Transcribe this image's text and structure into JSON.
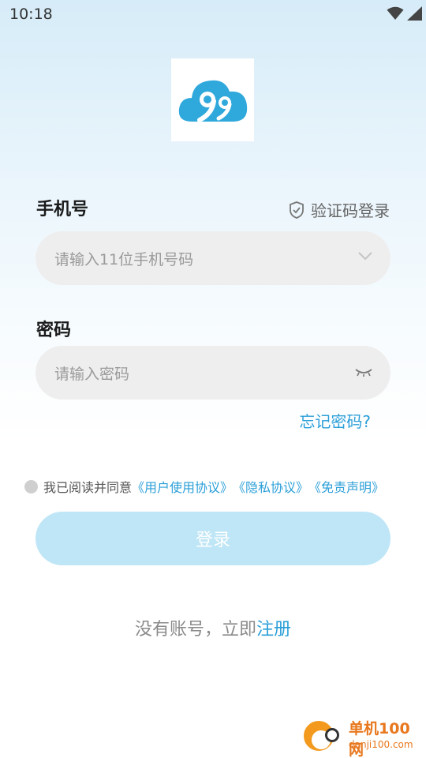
{
  "status_bar": {
    "time": "10:18",
    "icons": [
      "wifi-icon",
      "signal-icon",
      "battery-icon"
    ]
  },
  "logo": {
    "icon": "cloud-99-logo",
    "color": "#2fa8dc"
  },
  "phone": {
    "label": "手机号",
    "verify_login": "验证码登录",
    "placeholder": "请输入11位手机号码",
    "dropdown_icon": "chevron-down-icon"
  },
  "password": {
    "label": "密码",
    "placeholder": "请输入密码",
    "visibility_icon": "eye-closed-icon",
    "forgot": "忘记密码?"
  },
  "agreement": {
    "prefix": "我已阅读并同意",
    "user_agreement": "《用户使用协议》",
    "privacy": "《隐私协议》",
    "disclaimer": "《免责声明》"
  },
  "login_button": "登录",
  "register": {
    "prefix": "没有账号，立即",
    "link": "注册"
  },
  "watermark": {
    "title": "单机100网",
    "subtitle": "danji100.com"
  },
  "colors": {
    "accent": "#2b9fd8",
    "button_disabled": "#bfe6f6",
    "input_bg": "#eeeeee"
  }
}
